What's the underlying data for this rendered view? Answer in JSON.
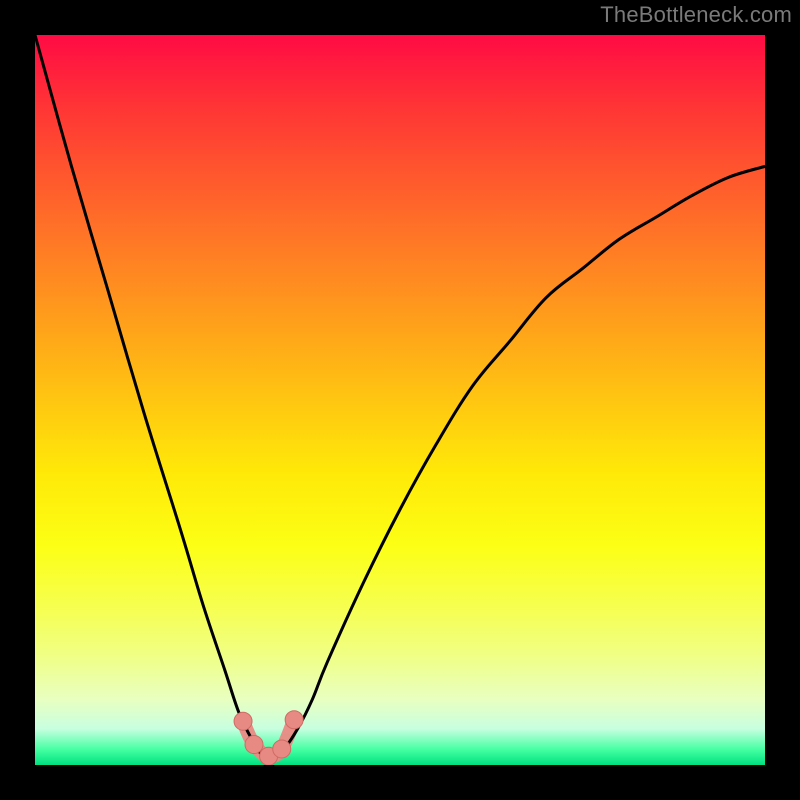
{
  "watermark": "TheBottleneck.com",
  "chart_data": {
    "type": "line",
    "title": "",
    "xlabel": "",
    "ylabel": "",
    "xlim": [
      0,
      100
    ],
    "ylim": [
      0,
      100
    ],
    "series": [
      {
        "name": "bottleneck-curve",
        "x": [
          0,
          5,
          10,
          15,
          20,
          23,
          26,
          28,
          30,
          31,
          32,
          33,
          34,
          36,
          38,
          40,
          45,
          50,
          55,
          60,
          65,
          70,
          75,
          80,
          85,
          90,
          95,
          100
        ],
        "values": [
          100,
          82,
          65,
          48,
          32,
          22,
          13,
          7,
          3,
          1.5,
          1,
          1.2,
          2,
          5,
          9,
          14,
          25,
          35,
          44,
          52,
          58,
          64,
          68,
          72,
          75,
          78,
          80.5,
          82
        ]
      }
    ],
    "markers": [
      {
        "name": "marker-left-upper",
        "x": 28.5,
        "y": 6.0
      },
      {
        "name": "marker-left-lower",
        "x": 30.0,
        "y": 2.8
      },
      {
        "name": "marker-min",
        "x": 32.0,
        "y": 1.2
      },
      {
        "name": "marker-right-lower",
        "x": 33.8,
        "y": 2.2
      },
      {
        "name": "marker-right-upper",
        "x": 35.5,
        "y": 6.2
      }
    ],
    "colors": {
      "curve": "#000000",
      "marker_fill": "#e88a84",
      "marker_stroke": "#d06a64",
      "connector": "#e88a84"
    }
  }
}
